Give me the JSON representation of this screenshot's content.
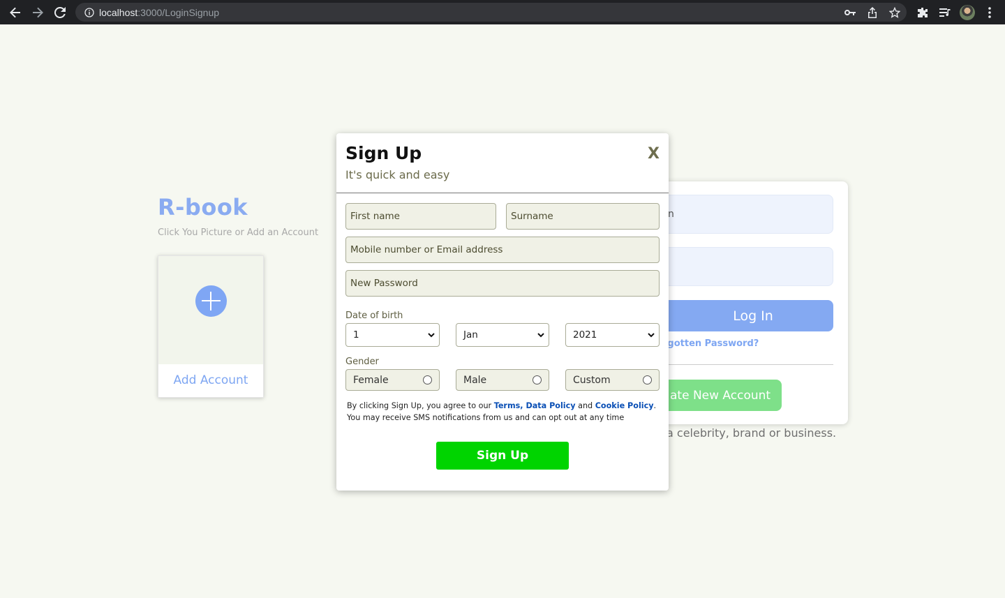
{
  "browser": {
    "url_host": "localhost",
    "url_path": ":3000/LoginSignup"
  },
  "background": {
    "brand": "R-book",
    "brand_subtitle": "Click You Picture or Add an Account",
    "add_account_label": "Add Account",
    "email_placeholder_fragment": "n",
    "login_button": "Log In",
    "forgot_password": "rgotten Password?",
    "create_account_button": "ate New Account",
    "create_page_text": "a celebrity, brand or business."
  },
  "signup": {
    "title": "Sign Up",
    "subtitle": "It's quick and easy",
    "close_label": "X",
    "first_name_placeholder": "First name",
    "surname_placeholder": "Surname",
    "contact_placeholder": "Mobile number or Email address",
    "password_placeholder": "New Password",
    "dob_label": "Date of birth",
    "dob_day": "1",
    "dob_month": "Jan",
    "dob_year": "2021",
    "gender_label": "Gender",
    "gender_options": [
      "Female",
      "Male",
      "Custom"
    ],
    "terms_part1": "By clicking Sign Up, you agree to our ",
    "terms_link": "Terms",
    "terms_comma": ", ",
    "data_policy_link": "Data Policy",
    "terms_and": " and ",
    "cookie_policy_link": "Cookie Policy",
    "terms_part2": ". You may receive SMS notifications from us and can opt out at any time",
    "submit_button": "Sign Up"
  },
  "colors": {
    "page_bg": "#f6f8f1",
    "brand_blue": "#8aabf1",
    "signup_green": "#00d400",
    "create_green": "#7ee089"
  }
}
